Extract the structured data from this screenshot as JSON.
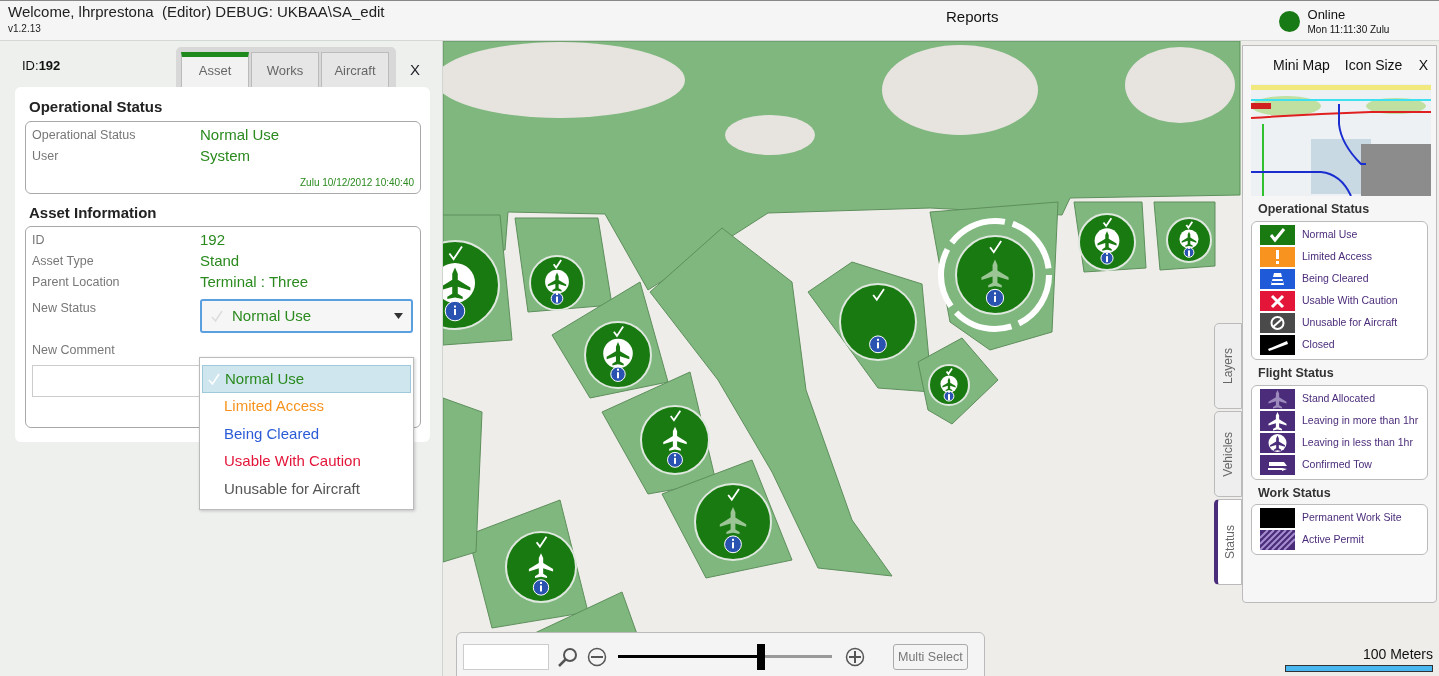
{
  "header": {
    "welcome": "Welcome, lhrprestona  (Editor) DEBUG: UKBAA\\SA_edit",
    "version": "v1.2.13",
    "title": "Reports",
    "connection": {
      "status": "Online",
      "online": true,
      "time": "Mon 11:11:30 Zulu"
    }
  },
  "asset_panel": {
    "id_text": "ID:**192**",
    "close": "X",
    "tabs": [
      {
        "label": "Asset",
        "selected": true
      },
      {
        "label": "Works",
        "selected": false
      },
      {
        "label": "Aircraft",
        "selected": false
      }
    ],
    "operational_status": {
      "heading": "Operational Status",
      "fields": [
        {
          "label": "Operational Status",
          "value": "Normal Use"
        },
        {
          "label": "User",
          "value": "System"
        }
      ],
      "timestamp": "Zulu 10/12/2012 10:40:40"
    },
    "asset_information": {
      "heading": "Asset Information",
      "fields": [
        {
          "label": "ID",
          "value": "192"
        },
        {
          "label": "Asset Type",
          "value": "Stand"
        },
        {
          "label": "Parent Location",
          "value": "Terminal : Three"
        }
      ],
      "new_status": {
        "label": "New Status",
        "value": "Normal Use",
        "expanded": true,
        "options": [
          {
            "label": "Normal Use",
            "selected": true,
            "color": "#2a8a1e"
          },
          {
            "label": "Limited Access",
            "selected": false,
            "color": "#f7931e"
          },
          {
            "label": "Being Cleared",
            "selected": false,
            "color": "#2a5bd7"
          },
          {
            "label": "Usable With Caution",
            "selected": false,
            "color": "#e3163a"
          },
          {
            "label": "Unusable for Aircraft",
            "selected": false,
            "color": "#555555"
          }
        ]
      },
      "new_comment": {
        "label": "New Comment"
      }
    }
  },
  "map": {
    "stands": [
      {
        "kind": "leaving_soon",
        "selected": false
      },
      {
        "kind": "leaving_soon",
        "selected": false
      },
      {
        "kind": "leaving_soon",
        "selected": false
      },
      {
        "kind": "leaving_later",
        "selected": false
      },
      {
        "kind": "allocated",
        "selected": false
      },
      {
        "kind": "leaving_later",
        "selected": false
      },
      {
        "kind": "none",
        "selected": false
      },
      {
        "kind": "allocated",
        "selected": true
      },
      {
        "kind": "leaving_soon",
        "selected": false
      },
      {
        "kind": "leaving_soon",
        "selected": false
      },
      {
        "kind": "leaving_soon",
        "selected": false
      }
    ]
  },
  "legend_panel": {
    "mini_map": "Mini Map",
    "icon_size": "Icon Size",
    "close": "X",
    "sections": [
      {
        "heading": "Operational Status",
        "items": [
          {
            "kind": "normal",
            "label": "Normal Use"
          },
          {
            "kind": "limited",
            "label": "Limited Access"
          },
          {
            "kind": "cleared",
            "label": "Being Cleared"
          },
          {
            "kind": "caution",
            "label": "Usable With Caution"
          },
          {
            "kind": "unusable",
            "label": "Unusable for Aircraft"
          },
          {
            "kind": "closed",
            "label": "Closed"
          }
        ]
      },
      {
        "heading": "Flight Status",
        "items": [
          {
            "kind": "allocated",
            "label": "Stand Allocated"
          },
          {
            "kind": "leaving_later",
            "label": "Leaving in more than 1hr"
          },
          {
            "kind": "leaving_soon",
            "label": "Leaving in less than 1hr"
          },
          {
            "kind": "tow",
            "label": "Confirmed Tow"
          }
        ]
      },
      {
        "heading": "Work Status",
        "items": [
          {
            "kind": "permanent",
            "label": "Permanent Work Site"
          },
          {
            "kind": "permit",
            "label": "Active Permit"
          }
        ]
      }
    ]
  },
  "side_tabs": [
    {
      "label": "Layers",
      "selected": false
    },
    {
      "label": "Vehicles",
      "selected": false
    },
    {
      "label": "Status",
      "selected": true
    }
  ],
  "toolbar": {
    "zoom": {
      "level": 0.67
    },
    "multi_select": "Multi Select"
  },
  "scale": {
    "label": "100 Meters"
  }
}
